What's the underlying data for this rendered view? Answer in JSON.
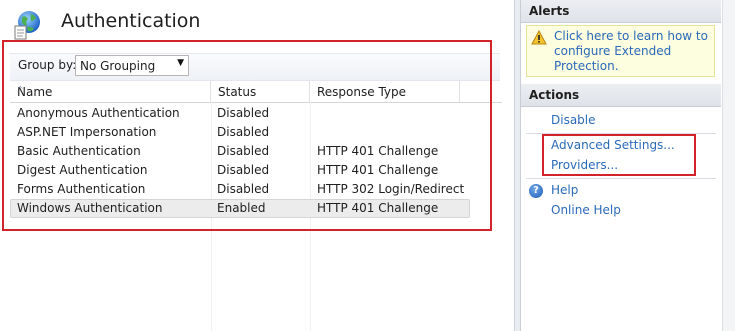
{
  "page": {
    "title": "Authentication",
    "icon": "globe-document-icon"
  },
  "grouping": {
    "label": "Group by:",
    "selected": "No Grouping"
  },
  "table": {
    "columns": [
      "Name",
      "Status",
      "Response Type"
    ],
    "rows": [
      {
        "name": "Anonymous Authentication",
        "status": "Disabled",
        "response": ""
      },
      {
        "name": "ASP.NET Impersonation",
        "status": "Disabled",
        "response": ""
      },
      {
        "name": "Basic Authentication",
        "status": "Disabled",
        "response": "HTTP 401 Challenge"
      },
      {
        "name": "Digest Authentication",
        "status": "Disabled",
        "response": "HTTP 401 Challenge"
      },
      {
        "name": "Forms Authentication",
        "status": "Disabled",
        "response": "HTTP 302 Login/Redirect"
      },
      {
        "name": "Windows Authentication",
        "status": "Enabled",
        "response": "HTTP 401 Challenge"
      }
    ],
    "selected_row": 5
  },
  "alerts": {
    "header": "Alerts",
    "message": "Click here to learn how to configure Extended Protection.",
    "icon": "warning-icon"
  },
  "actions": {
    "header": "Actions",
    "disable": "Disable",
    "advanced_settings": "Advanced Settings...",
    "providers": "Providers...",
    "help": "Help",
    "online_help": "Online Help",
    "help_icon": "help-icon"
  },
  "colors": {
    "link": "#2a6ab8",
    "highlight_box": "#d2232a",
    "alert_bg": "#fdfde0"
  }
}
